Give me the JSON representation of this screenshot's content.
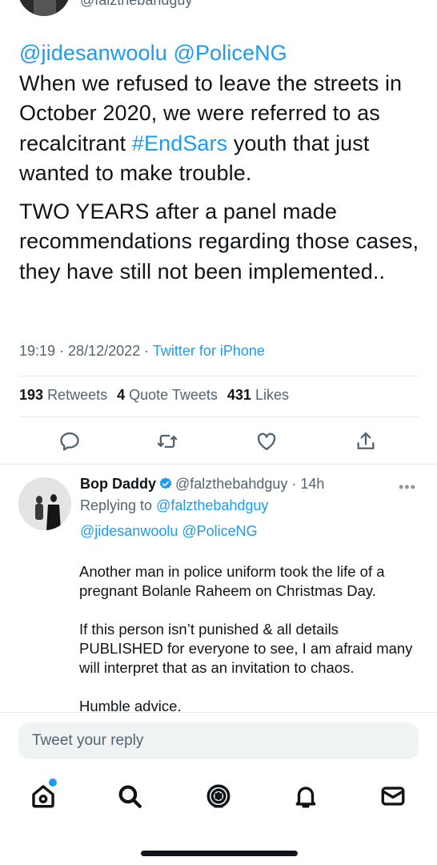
{
  "top": {
    "handle": "@falzthebahdguy"
  },
  "tweet": {
    "mention1": "@jidesanwoolu",
    "mention2": "@PoliceNG",
    "line1a": "When we refused to leave the streets in October 2020, we were referred to as recalcitrant ",
    "hashtag": "#EndSars",
    "line1b": " youth that just wanted to make trouble.",
    "para2": "TWO YEARS after a panel made recommendations regarding those cases, they have still not been implemented.."
  },
  "meta": {
    "time": "19:19",
    "sep": " · ",
    "date": "28/12/2022",
    "sep2": " · ",
    "source": "Twitter for iPhone"
  },
  "stats": {
    "retweets_count": "193",
    "retweets_label": "Retweets",
    "quotes_count": "4",
    "quotes_label": "Quote Tweets",
    "likes_count": "431",
    "likes_label": "Likes"
  },
  "actions": {
    "icons": [
      "reply-icon",
      "retweet-icon",
      "like-icon",
      "share-icon"
    ]
  },
  "reply": {
    "name": "Bop Daddy",
    "handle": "@falzthebahdguy",
    "dot": " · ",
    "time": "14h",
    "more": "•••",
    "replying_label": "Replying to ",
    "replying_handle": "@falzthebahdguy",
    "mention1": "@jidesanwoolu",
    "mention2": "@PoliceNG",
    "p1": "Another man in police uniform took the life of a pregnant Bolanle Raheem on Christmas Day.",
    "p2": "If this person isn’t punished & all details PUBLISHED for everyone to see, I am afraid many will  interpret that as an invitation to chaos.",
    "p3": "Humble advice."
  },
  "compose": {
    "placeholder": "Tweet your reply"
  },
  "nav": {
    "icons": [
      "home-icon",
      "search-icon",
      "spaces-icon",
      "notifications-icon",
      "messages-icon"
    ]
  },
  "colors": {
    "accent": "#1d9bf0",
    "text": "#0f1419",
    "secondary": "#536471"
  }
}
